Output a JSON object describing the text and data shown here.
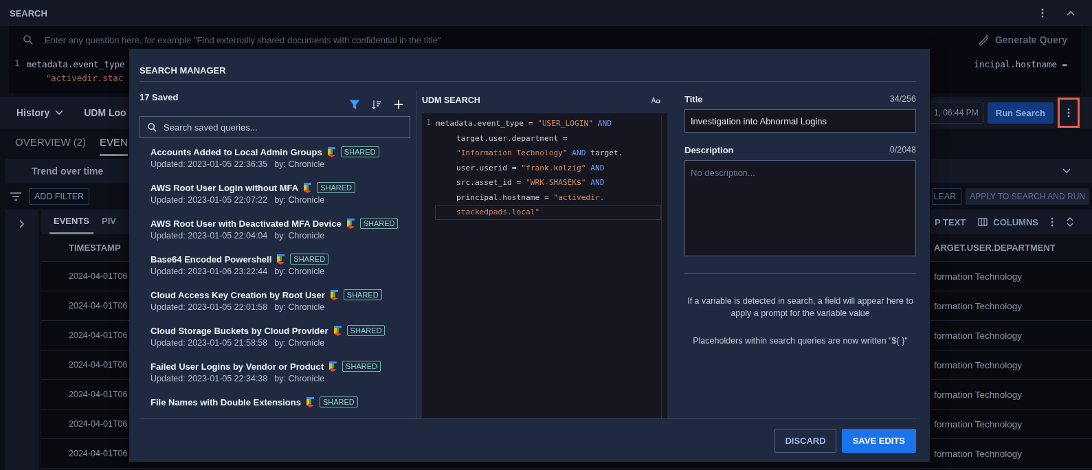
{
  "search_panel": {
    "title": "SEARCH",
    "query_placeholder": "Enter any question here, for example \"Find externally shared documents with confidential in the title\"",
    "generate_query": "Generate Query",
    "editor": {
      "line_number": "1",
      "left_lines": [
        "metadata.event_type",
        "\"activedir.stac"
      ],
      "right_line": "incipal.hostname ="
    }
  },
  "toolbar": {
    "history": "History",
    "udm_lookup": "UDM Loo",
    "time_range": "1, 06:44 PM",
    "run_search": "Run Search",
    "more_highlighted": true
  },
  "result_tabs": [
    {
      "label": "OVERVIEW (2)",
      "selected": false
    },
    {
      "label": "EVEN",
      "selected": true
    }
  ],
  "trend": {
    "label": "Trend over time"
  },
  "filter_bar": {
    "add_filter": "ADD FILTER",
    "clear": "LEAR",
    "apply": "APPLY TO SEARCH AND RUN"
  },
  "events_tabs": [
    {
      "label": "EVENTS",
      "selected": true
    },
    {
      "label": "PIV",
      "selected": false
    }
  ],
  "events_toolbar": {
    "wrap_text": "P TEXT",
    "columns": "COLUMNS"
  },
  "table": {
    "columns": [
      "TIMESTAMP",
      "ARGET.USER.DEPARTMENT"
    ],
    "rows": [
      [
        "2024-04-01T06",
        "formation Technology"
      ],
      [
        "2024-04-01T06",
        "formation Technology"
      ],
      [
        "2024-04-01T06",
        "formation Technology"
      ],
      [
        "2024-04-01T06",
        "formation Technology"
      ],
      [
        "2024-04-01T06",
        "formation Technology"
      ],
      [
        "2024-04-01T06",
        "formation Technology"
      ],
      [
        "2024-04-01T06",
        "formation Technology"
      ]
    ]
  },
  "search_manager": {
    "title": "SEARCH MANAGER",
    "saved_count": "17 Saved",
    "filter_active": true,
    "search_placeholder": "Search saved queries...",
    "queries": [
      {
        "title": "Accounts Added to Local Admin Groups",
        "shared": "SHARED",
        "updated": "Updated: 2023-01-05 22:36:35",
        "by": "by: Chronicle"
      },
      {
        "title": "AWS Root User Login without MFA",
        "shared": "SHARED",
        "updated": "Updated: 2023-01-05 22:07:22",
        "by": "by: Chronicle"
      },
      {
        "title": "AWS Root User with Deactivated MFA Device",
        "shared": "SHARED",
        "updated": "Updated: 2023-01-05 22:04:04",
        "by": "by: Chronicle"
      },
      {
        "title": "Base64 Encoded Powershell",
        "shared": "SHARED",
        "updated": "Updated: 2023-01-06 23:22:44",
        "by": "by: Chronicle"
      },
      {
        "title": "Cloud Access Key Creation by Root User",
        "shared": "SHARED",
        "updated": "Updated: 2023-01-05 22:01:58",
        "by": "by: Chronicle"
      },
      {
        "title": "Cloud Storage Buckets by Cloud Provider",
        "shared": "SHARED",
        "updated": "Updated: 2023-01-05 21:58:58",
        "by": "by: Chronicle"
      },
      {
        "title": "Failed User Logins by Vendor or Product",
        "shared": "SHARED",
        "updated": "Updated: 2023-01-05 22:34:38",
        "by": "by: Chronicle"
      },
      {
        "title": "File Names with Double Extensions",
        "shared": "SHARED"
      }
    ],
    "editor": {
      "title": "UDM SEARCH",
      "line_number": "1",
      "lines": [
        {
          "current": false,
          "tokens": [
            {
              "kind": "field",
              "text": "metadata.event_type ="
            },
            {
              "kind": "string",
              "text": "\"USER_LOGIN\""
            },
            {
              "kind": "keyword",
              "text": "AND"
            }
          ]
        },
        {
          "current": false,
          "tokens": [
            {
              "kind": "field",
              "text": "target.user.department ="
            }
          ]
        },
        {
          "current": false,
          "tokens": [
            {
              "kind": "string",
              "text": "\"Information Technology\""
            },
            {
              "kind": "keyword",
              "text": "AND"
            },
            {
              "kind": "field",
              "text": "target."
            }
          ]
        },
        {
          "current": false,
          "tokens": [
            {
              "kind": "field",
              "text": "user.userid ="
            },
            {
              "kind": "string",
              "text": "\"frank.kolzig\""
            },
            {
              "kind": "keyword",
              "text": "AND"
            }
          ]
        },
        {
          "current": false,
          "tokens": [
            {
              "kind": "field",
              "text": "src.asset_id ="
            },
            {
              "kind": "string",
              "text": "\"WRK-SHASEK$\""
            },
            {
              "kind": "keyword",
              "text": "AND"
            }
          ]
        },
        {
          "current": false,
          "tokens": [
            {
              "kind": "field",
              "text": "principal.hostname ="
            },
            {
              "kind": "string",
              "text": "\"activedir."
            }
          ]
        },
        {
          "current": true,
          "tokens": [
            {
              "kind": "string",
              "text": "stackedpads.local\""
            }
          ]
        }
      ]
    },
    "form": {
      "title_label": "Title",
      "title_count": "34/256",
      "title_value": "Investigation into Abnormal Logins",
      "description_label": "Description",
      "description_count": "0/2048",
      "description_placeholder": "No description...",
      "info": [
        "If a variable is detected in search, a field will appear here to apply a prompt for the variable value",
        "Placeholders within search queries are now written \"${ }\""
      ]
    },
    "discard": "DISCARD",
    "save": "SAVE EDITS"
  }
}
